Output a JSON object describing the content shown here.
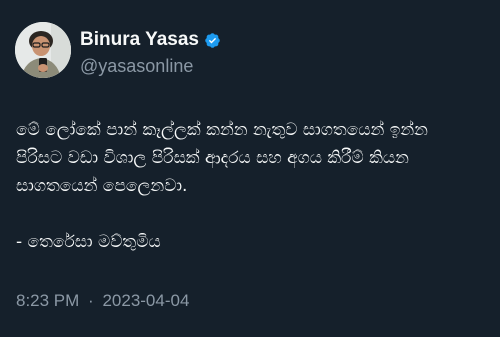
{
  "author": {
    "display_name": "Binura Yasas",
    "handle": "@yasasonline",
    "verified": true,
    "verified_color": "#1d9bf0"
  },
  "tweet": {
    "lines": [
      "මේ ලෝකේ පාන් කෑල්ලක් කන්න නැතුව සාගතයෙන් ඉන්න",
      "පිරිසට වඩා විශාල පිරිසක් ආදරය සහ අගය කිරීම් කියන",
      "සාගතයෙන් පෙලෙනවා."
    ],
    "attribution": "- තෙරේසා මව්තුමිය"
  },
  "meta": {
    "time": "8:23 PM",
    "separator": "·",
    "date": "2023-04-04"
  },
  "colors": {
    "background": "#15202b",
    "text": "#f7f9f9",
    "muted": "#8b98a5"
  }
}
